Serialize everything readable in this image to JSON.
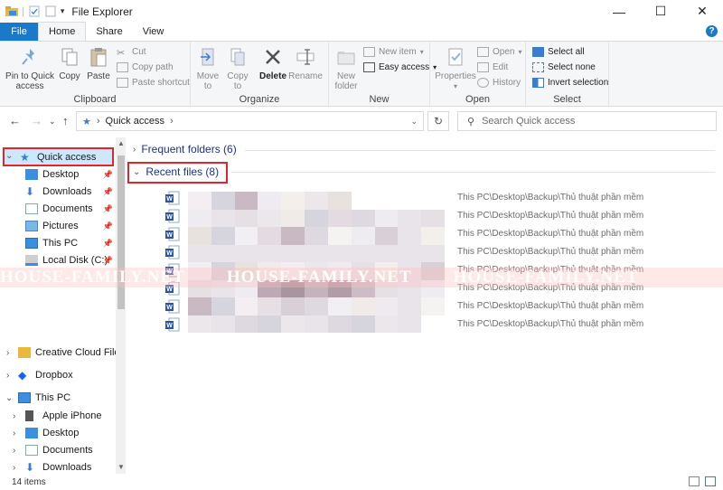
{
  "window": {
    "title": "File Explorer"
  },
  "tabs": [
    "File",
    "Home",
    "Share",
    "View"
  ],
  "ribbon": {
    "clipboard": {
      "pin": [
        "Pin to Quick",
        "access"
      ],
      "copy": "Copy",
      "paste": "Paste",
      "cut": "Cut",
      "copy_path": "Copy path",
      "paste_shortcut": "Paste shortcut",
      "name": "Clipboard"
    },
    "organize": {
      "move_to": [
        "Move",
        "to"
      ],
      "copy_to": [
        "Copy",
        "to"
      ],
      "delete": "Delete",
      "rename": "Rename",
      "name": "Organize"
    },
    "new": {
      "new_folder": [
        "New",
        "folder"
      ],
      "new_item": "New item",
      "easy_access": "Easy access",
      "name": "New"
    },
    "open": {
      "properties": "Properties",
      "open": "Open",
      "edit": "Edit",
      "history": "History",
      "name": "Open"
    },
    "select": {
      "select_all": "Select all",
      "select_none": "Select none",
      "invert": "Invert selection",
      "name": "Select"
    }
  },
  "address": {
    "path": "Quick access",
    "search_placeholder": "Search Quick access"
  },
  "nav": {
    "quick_access": "Quick access",
    "qa_items": [
      "Desktop",
      "Downloads",
      "Documents",
      "Pictures",
      "This PC",
      "Local Disk (C:)"
    ],
    "creative_cloud": "Creative Cloud Files",
    "dropbox": "Dropbox",
    "this_pc": "This PC",
    "pc_items": [
      "Apple iPhone",
      "Desktop",
      "Documents",
      "Downloads"
    ]
  },
  "content": {
    "frequent": "Frequent folders (6)",
    "recent": "Recent files (8)",
    "file_path": "This PC\\Desktop\\Backup\\Thủ thuật phần mềm",
    "file_count": 8
  },
  "watermark": "HOUSE-FAMILY.NET",
  "status": {
    "items": "14 items"
  },
  "colors": {
    "accent": "#1979ca",
    "highlight": "#e2242b",
    "selection": "#cce8ff"
  }
}
